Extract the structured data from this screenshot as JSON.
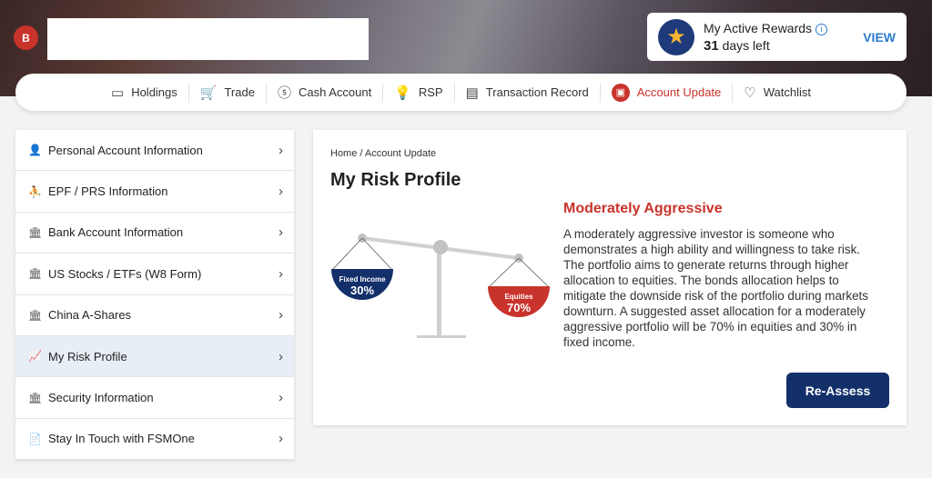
{
  "header": {
    "avatar_initial": "B",
    "rewards": {
      "title": "My Active Rewards",
      "days": "31",
      "days_suffix": "days left",
      "view_label": "VIEW"
    }
  },
  "nav": [
    {
      "label": "Holdings",
      "icon": "wallet-icon",
      "glyph": "▭"
    },
    {
      "label": "Trade",
      "icon": "cart-icon",
      "glyph": "🛒"
    },
    {
      "label": "Cash Account",
      "icon": "dollar-icon",
      "glyph": "ⓢ"
    },
    {
      "label": "RSP",
      "icon": "bulb-icon",
      "glyph": "💡"
    },
    {
      "label": "Transaction Record",
      "icon": "clipboard-icon",
      "glyph": "▤"
    },
    {
      "label": "Account Update",
      "icon": "account-update-icon",
      "glyph": "▣",
      "active": true
    },
    {
      "label": "Watchlist",
      "icon": "heart-icon",
      "glyph": "♡"
    }
  ],
  "menu": [
    {
      "label": "Personal Account Information",
      "icon": "user-icon",
      "glyph": "👤"
    },
    {
      "label": "EPF / PRS Information",
      "icon": "person-cane-icon",
      "glyph": "⛹"
    },
    {
      "label": "Bank Account Information",
      "icon": "bank-icon",
      "glyph": "🏛"
    },
    {
      "label": "US Stocks / ETFs (W8 Form)",
      "icon": "bank-icon",
      "glyph": "🏛"
    },
    {
      "label": "China A-Shares",
      "icon": "bank-icon",
      "glyph": "🏛"
    },
    {
      "label": "My Risk Profile",
      "icon": "chart-presentation-icon",
      "glyph": "📈",
      "active": true
    },
    {
      "label": "Security Information",
      "icon": "bank-icon",
      "glyph": "🏛"
    },
    {
      "label": "Stay In Touch with FSMOne",
      "icon": "document-icon",
      "glyph": "📄"
    }
  ],
  "main": {
    "breadcrumb": "Home / Account Update",
    "title": "My Risk Profile",
    "allocation": {
      "fixed_income_label": "Fixed Income",
      "fixed_income_pct": "30%",
      "equities_label": "Equities",
      "equities_pct": "70%"
    },
    "risk_level": "Moderately Aggressive",
    "description": "A moderately aggressive investor is someone who demonstrates a high ability and willingness to take risk. The portfolio aims to generate returns through higher allocation to equities. The bonds allocation helps to mitigate the downside risk of the portfolio during markets downturn. A suggested asset allocation for a moderately aggressive portfolio will be 70% in equities and 30% in fixed income.",
    "reassess_label": "Re-Assess"
  },
  "colors": {
    "accent_red": "#c8332b",
    "navy": "#13306a",
    "link_blue": "#2a7bd0"
  }
}
